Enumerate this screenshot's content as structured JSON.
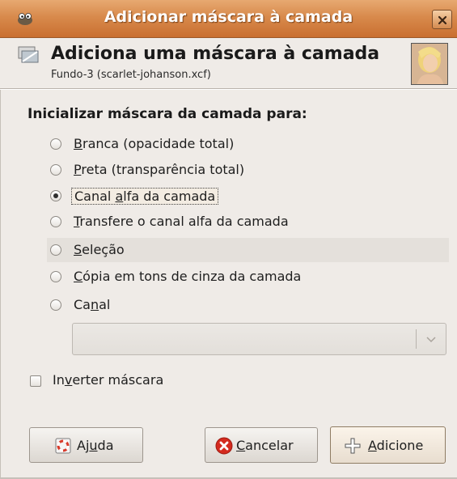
{
  "window": {
    "title": "Adicionar máscara à camada",
    "app_icon": "gimp-wilber-icon",
    "close_icon": "close-icon"
  },
  "header": {
    "icon": "layer-mask-icon",
    "title": "Adiciona uma máscara à camada",
    "subtitle": "Fundo-3 (scarlet-johanson.xcf)",
    "thumbnail": "layer-thumbnail"
  },
  "section": {
    "label": "Inicializar máscara da camada para:"
  },
  "options": [
    {
      "pre": "",
      "key": "B",
      "post": "ranca (opacidade total)",
      "checked": false
    },
    {
      "pre": "",
      "key": "P",
      "post": "reta (transparência total)",
      "checked": false
    },
    {
      "pre": "Canal ",
      "key": "a",
      "post": "lfa da camada",
      "checked": true
    },
    {
      "pre": "",
      "key": "T",
      "post": "ransfere o canal alfa da camada",
      "checked": false
    },
    {
      "pre": "",
      "key": "S",
      "post": "eleção",
      "checked": false
    },
    {
      "pre": "",
      "key": "C",
      "post": "ópia em tons de cinza da camada",
      "checked": false
    },
    {
      "pre": "Ca",
      "key": "n",
      "post": "al",
      "checked": false
    }
  ],
  "channel_combo": {
    "value": "",
    "icon": "chevron-down-icon"
  },
  "invert": {
    "pre": "In",
    "key": "v",
    "post": "erter máscara",
    "checked": false
  },
  "buttons": {
    "help": {
      "pre": "Aj",
      "key": "u",
      "post": "da",
      "icon": "help-lifebuoy-icon"
    },
    "cancel": {
      "pre": "",
      "key": "C",
      "post": "ancelar",
      "icon": "cancel-icon"
    },
    "add": {
      "pre": "",
      "key": "A",
      "post": "dicione",
      "icon": "add-plus-icon"
    }
  },
  "colors": {
    "titlebar": "#d88a4c",
    "background": "#efebe7",
    "cancel_red": "#d42a1e"
  }
}
